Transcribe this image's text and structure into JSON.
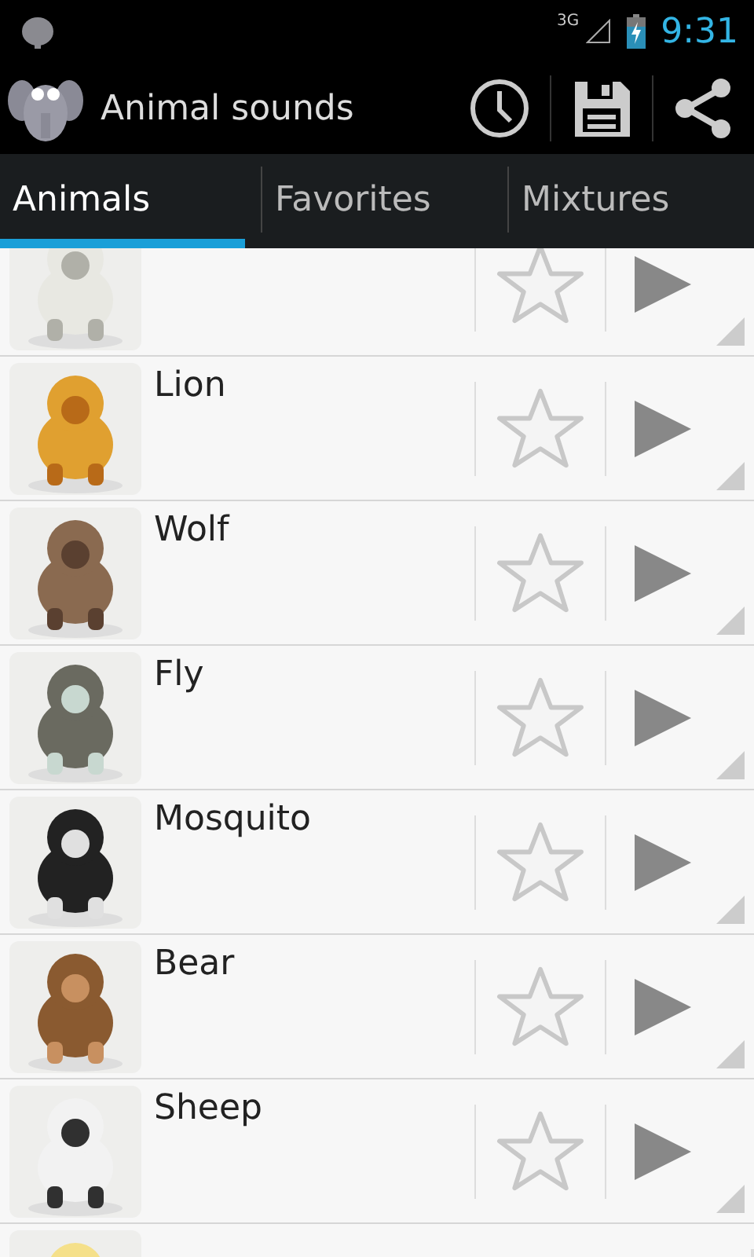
{
  "status_bar": {
    "network": "3G",
    "time": "9:31"
  },
  "app_bar": {
    "title": "Animal sounds"
  },
  "tabs": [
    {
      "label": "Animals",
      "selected": true
    },
    {
      "label": "Favorites",
      "selected": false
    },
    {
      "label": "Mixtures",
      "selected": false
    }
  ],
  "animals": [
    {
      "favorite": false
    },
    {
      "name": "Lion",
      "favorite": false
    },
    {
      "name": "Wolf",
      "favorite": false
    },
    {
      "name": "Fly",
      "favorite": false
    },
    {
      "name": "Mosquito",
      "favorite": false
    },
    {
      "name": "Bear",
      "favorite": false
    },
    {
      "name": "Sheep",
      "favorite": false
    },
    {
      "kind": "picture"
    }
  ]
}
